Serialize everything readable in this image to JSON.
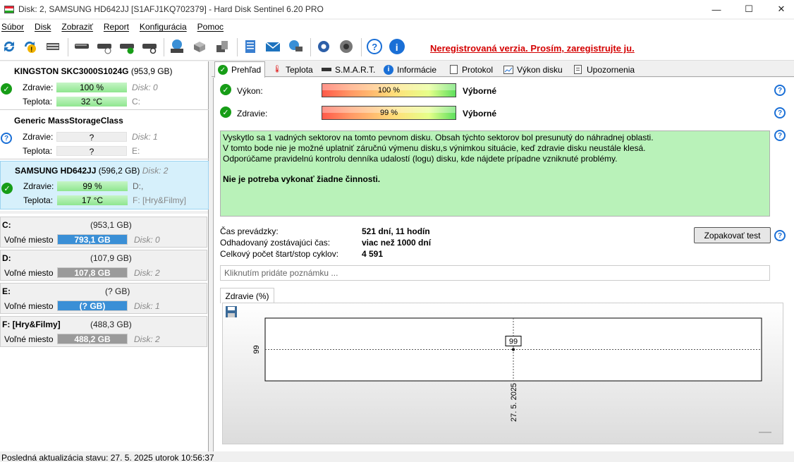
{
  "window": {
    "title": "Disk: 2, SAMSUNG HD642JJ [S1AFJ1KQ702379]  -  Hard Disk Sentinel 6.20 PRO",
    "minimize": "—",
    "maximize": "☐",
    "close": "✕"
  },
  "menu": [
    "Súbor",
    "Disk",
    "Zobraziť",
    "Report",
    "Konfigurácia",
    "Pomoc"
  ],
  "toolbar": {
    "unregistered": "Neregistrovaná verzia. Prosím, zaregistrujte ju."
  },
  "disks": [
    {
      "name": "KINGSTON SKC3000S1024G",
      "size": "(953,9 GB)",
      "health_label": "Zdravie:",
      "health": "100 %",
      "disk_id": "Disk: 0",
      "temp_label": "Teplota:",
      "temp": "32 °C",
      "vol": "C:",
      "status": "ok"
    },
    {
      "name": "Generic MassStorageClass",
      "size": "",
      "health_label": "Zdravie:",
      "health": "?",
      "disk_id": "Disk: 1",
      "temp_label": "Teplota:",
      "temp": "?",
      "vol": "E:",
      "status": "unknown"
    },
    {
      "name": "SAMSUNG HD642JJ",
      "size": "(596,2 GB)",
      "extra": "Disk: 2",
      "health_label": "Zdravie:",
      "health": "99 %",
      "disk_id": "D:,",
      "temp_label": "Teplota:",
      "temp": "17 °C",
      "vol": "F: [Hry&Filmy]",
      "status": "ok"
    }
  ],
  "volumes": [
    {
      "name": "C:",
      "size": "(953,1 GB)",
      "free_label": "Voľné miesto",
      "free": "793,1 GB",
      "disk": "Disk: 0",
      "fill": 0.1,
      "color": "#3a8fd6"
    },
    {
      "name": "D:",
      "size": "(107,9 GB)",
      "free_label": "Voľné miesto",
      "free": "107,8 GB",
      "disk": "Disk: 2",
      "fill": 0.02,
      "color": "#9a9a9a"
    },
    {
      "name": "E:",
      "size": "(? GB)",
      "free_label": "Voľné miesto",
      "free": "(? GB)",
      "disk": "Disk: 1",
      "fill": 0,
      "color": "#3a8fd6"
    },
    {
      "name": "F: [Hry&Filmy]",
      "size": "(488,3 GB)",
      "free_label": "Voľné miesto",
      "free": "488,2 GB",
      "disk": "Disk: 2",
      "fill": 0.01,
      "color": "#9a9a9a"
    }
  ],
  "tabs": [
    "Prehľad",
    "Teplota",
    "S.M.A.R.T.",
    "Informácie",
    "Protokol",
    "Výkon disku",
    "Upozornenia"
  ],
  "overview": {
    "performance_label": "Výkon:",
    "performance_pct": "100 %",
    "performance_rating": "Výborné",
    "health_label": "Zdravie:",
    "health_pct": "99 %",
    "health_rating": "Výborné",
    "message_lines": [
      "Vyskytlo sa 1 vadných sektorov na tomto pevnom disku. Obsah týchto sektorov bol presunutý do náhradnej oblasti.",
      "V tomto bode nie je možné uplatniť záručnú výmenu disku,s výnimkou situácie, keď zdravie disku neustále klesá.",
      "Odporúčame pravidelnú kontrolu denníka udalostí (logu) disku, kde nájdete prípadne vzniknuté problémy."
    ],
    "message_action": "Nie je potreba vykonať žiadne činnosti.",
    "uptime_label": "Čas prevádzky:",
    "uptime": "521 dní, 11 hodín",
    "remaining_label": "Odhadovaný zostávajúci čas:",
    "remaining": "viac než 1000 dní",
    "cycles_label": "Celkový počet štart/stop cyklov:",
    "cycles": "4 591",
    "repeat_button": "Zopakovať test",
    "note_placeholder": "Kliknutím pridáte poznámku ..."
  },
  "graph": {
    "tab": "Zdravie (%)"
  },
  "chart_data": {
    "type": "line",
    "x": [
      "27. 5. 2025"
    ],
    "values": [
      99
    ],
    "ylabel": "",
    "xlabel": "",
    "point_label": "99",
    "y_tick": "99"
  },
  "statusbar": "Posledná aktualizácia stavu: 27. 5. 2025 utorok 10:56:37",
  "colors": {
    "unregistered": "#d40000",
    "healthy_bar": "#8fe68f",
    "selected_disk": "#d6f0fb",
    "message_bg": "#b9f2b9"
  }
}
